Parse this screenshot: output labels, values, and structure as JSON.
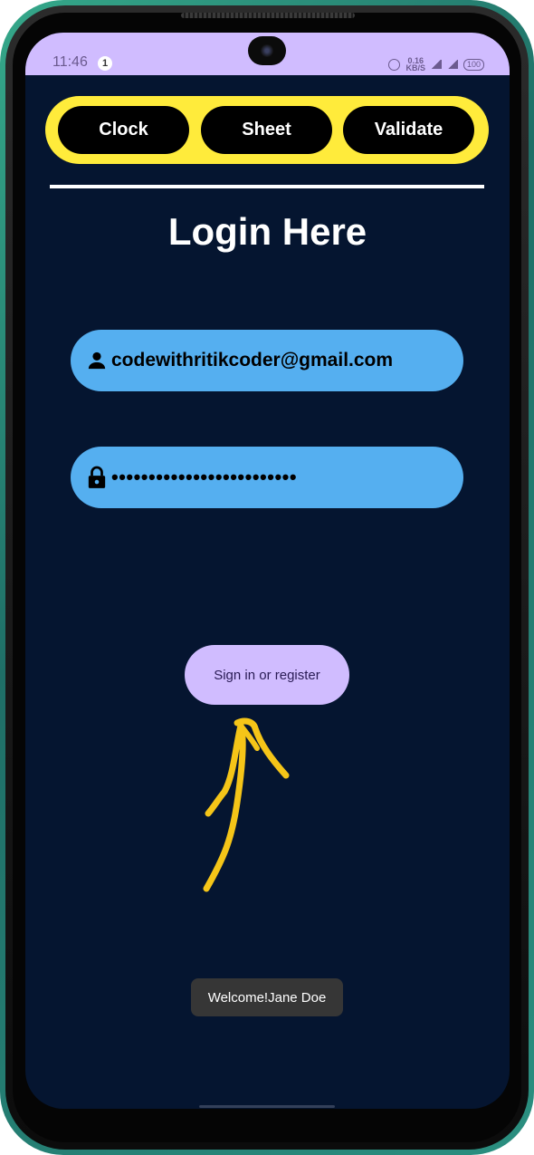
{
  "status_bar": {
    "time": "11:46",
    "notification_count": "1",
    "net_speed_value": "0.16",
    "net_speed_unit": "KB/S",
    "battery": "100"
  },
  "top_tabs": {
    "items": [
      {
        "label": "Clock"
      },
      {
        "label": "Sheet"
      },
      {
        "label": "Validate"
      }
    ]
  },
  "login": {
    "title": "Login Here",
    "email_value": "codewithritikcoder@gmail.com",
    "password_masked": "•••••••••••••••••••••••••",
    "submit_label": "Sign in or register"
  },
  "toast": {
    "message": "Welcome!Jane Doe"
  },
  "colors": {
    "background": "#051530",
    "statusbar": "#d0bcff",
    "segment_bg": "#ffeb3b",
    "field_bg": "#55aff0",
    "button_bg": "#d0bcff",
    "annotation_arrow": "#f5c518"
  },
  "icons": {
    "email": "person-icon",
    "password": "lock-icon",
    "annotation": "hand-drawn-arrow-icon"
  }
}
